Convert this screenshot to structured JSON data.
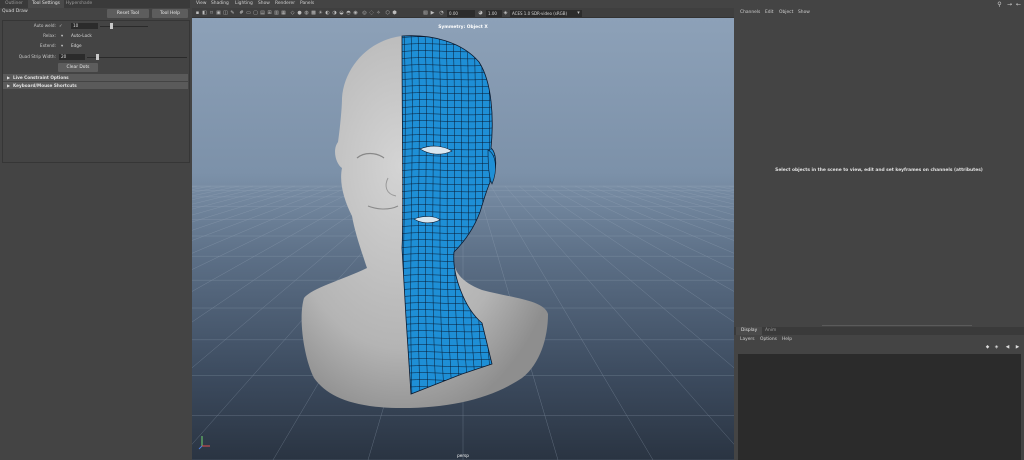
{
  "left_panel": {
    "tabs": [
      "Outliner",
      "Tool Settings",
      "Hypershade"
    ],
    "active_tab": 1,
    "tool_title": "Quad Draw",
    "reset_tool_label": "Reset Tool",
    "tool_help_label": "Tool Help",
    "rows": {
      "autoweld_label": "Auto weld:",
      "autoweld_check": "✓",
      "autoweld_value": "10",
      "relax_label": "Relax:",
      "relax_value": "Auto-Lock",
      "extend_label": "Extend:",
      "extend_value": "Edge",
      "quad_strip_label": "Quad Strip Width:",
      "quad_strip_value": "20"
    },
    "clear_dots_label": "Clear Dots",
    "sections": [
      "Live Constraint Options",
      "Keyboard/Mouse Shortcuts"
    ]
  },
  "viewport": {
    "menu": [
      "View",
      "Shading",
      "Lighting",
      "Show",
      "Renderer",
      "Panels"
    ],
    "toolbar": {
      "exposure": "0.00",
      "gamma": "1.00",
      "color_space": "ACES 1.0 SDR-video (sRGB)"
    },
    "symmetry_label": "Symmetry: Object X",
    "camera_label": "persp"
  },
  "right_panel": {
    "menu": [
      "Channels",
      "Edit",
      "Object",
      "Show"
    ],
    "empty_message": "Select objects in the scene to view, edit and set keyframes on channels (attributes)",
    "layer_tabs": [
      "Display",
      "Anim"
    ],
    "layer_menu": [
      "Layers",
      "Options",
      "Help"
    ]
  },
  "icons": {
    "top_right": [
      "figure-icon",
      "arrow-right-icon",
      "arrow-left-icon"
    ],
    "layer_buttons": [
      "new-layer-icon",
      "new-selected-layer-icon",
      "move-up-icon",
      "move-down-icon"
    ]
  },
  "colors": {
    "mesh_blue": "#1e8fd6",
    "mesh_line": "#0a1a30",
    "head_grey": "#bcbcbc"
  }
}
